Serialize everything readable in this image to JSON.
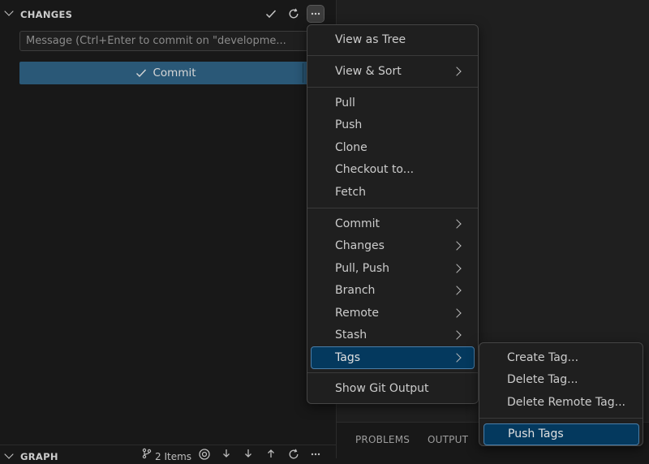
{
  "changes_section": {
    "title": "CHANGES",
    "message_placeholder": "Message (Ctrl+Enter to commit on \"developme...",
    "commit_label": "Commit"
  },
  "menu": {
    "items": [
      {
        "label": "View as Tree"
      },
      {
        "label": "View & Sort"
      },
      {
        "label": "Pull"
      },
      {
        "label": "Push"
      },
      {
        "label": "Clone"
      },
      {
        "label": "Checkout to..."
      },
      {
        "label": "Fetch"
      },
      {
        "label": "Commit"
      },
      {
        "label": "Changes"
      },
      {
        "label": "Pull, Push"
      },
      {
        "label": "Branch"
      },
      {
        "label": "Remote"
      },
      {
        "label": "Stash"
      },
      {
        "label": "Tags"
      },
      {
        "label": "Show Git Output"
      }
    ]
  },
  "tags_submenu": {
    "items": [
      {
        "label": "Create Tag..."
      },
      {
        "label": "Delete Tag..."
      },
      {
        "label": "Delete Remote Tag..."
      },
      {
        "label": "Push Tags"
      }
    ]
  },
  "panel": {
    "tabs": [
      {
        "label": "PROBLEMS"
      },
      {
        "label": "OUTPUT"
      }
    ]
  },
  "graph_section": {
    "title": "GRAPH",
    "items_label": "2 Items"
  },
  "icons": {
    "commit_check": "check-icon",
    "refresh": "refresh-icon",
    "more": "more-actions-icon"
  },
  "colors": {
    "accent": "#2a5877",
    "selection": "#04395e",
    "selection_border": "#4a7ea8"
  }
}
